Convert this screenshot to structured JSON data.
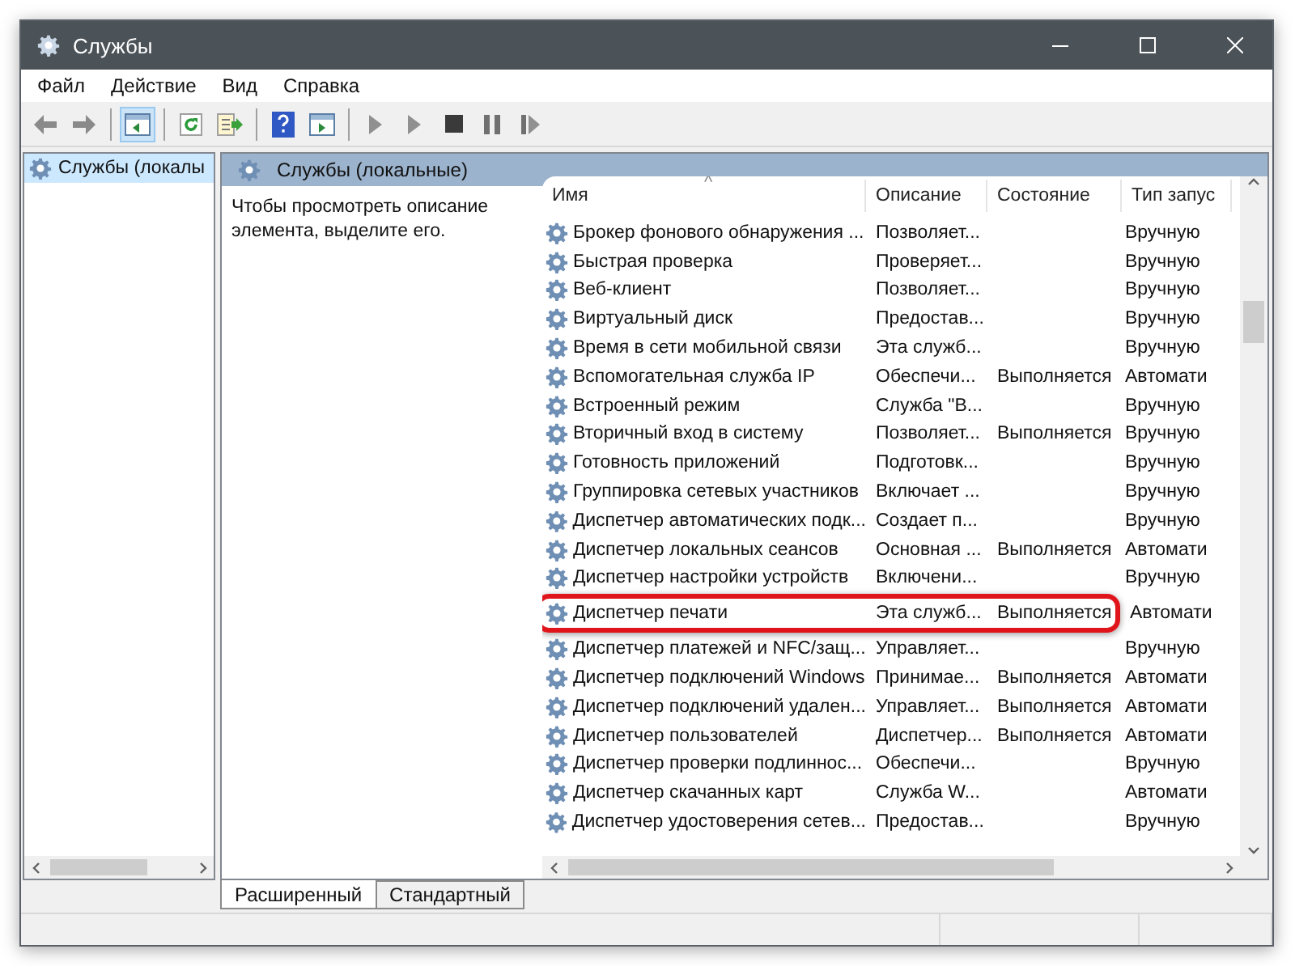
{
  "window": {
    "title": "Службы"
  },
  "menu": [
    "Файл",
    "Действие",
    "Вид",
    "Справка"
  ],
  "toolbar": [
    {
      "kind": "back",
      "pressed": false
    },
    {
      "kind": "forward",
      "pressed": false
    },
    {
      "kind": "sep"
    },
    {
      "kind": "tree",
      "pressed": true
    },
    {
      "kind": "sep"
    },
    {
      "kind": "refresh",
      "pressed": false
    },
    {
      "kind": "export",
      "pressed": false
    },
    {
      "kind": "sep"
    },
    {
      "kind": "help",
      "pressed": false
    },
    {
      "kind": "view",
      "pressed": false
    },
    {
      "kind": "sep"
    },
    {
      "kind": "start",
      "pressed": false
    },
    {
      "kind": "start",
      "pressed": false
    },
    {
      "kind": "stop",
      "pressed": false
    },
    {
      "kind": "pause",
      "pressed": false
    },
    {
      "kind": "resume",
      "pressed": false
    }
  ],
  "tree": {
    "items": [
      {
        "label": "Службы (локалы",
        "selected": true
      }
    ]
  },
  "panel": {
    "title": "Службы (локальные)",
    "description": "Чтобы просмотреть описание элемента, выделите его."
  },
  "table": {
    "sort_indicator": "^",
    "columns": [
      "Имя",
      "Описание",
      "Состояние",
      "Тип запус"
    ],
    "rows": [
      {
        "name": "Брокер фонового обнаружения ...",
        "description": "Позволяет...",
        "startup": "Вручную",
        "highlighted": false
      },
      {
        "name": "Быстрая проверка",
        "description": "Проверяет...",
        "startup": "Вручную",
        "highlighted": false
      },
      {
        "name": "Веб-клиент",
        "description": "Позволяет...",
        "startup": "Вручную",
        "highlighted": false
      },
      {
        "name": "Виртуальный диск",
        "description": "Предостав...",
        "startup": "Вручную",
        "highlighted": false
      },
      {
        "name": "Время в сети мобильной связи",
        "description": "Эта служб...",
        "startup": "Вручную",
        "highlighted": false
      },
      {
        "name": "Вспомогательная служба IP",
        "description": "Обеспечи...",
        "status": "Выполняется",
        "startup": "Автомати",
        "highlighted": false
      },
      {
        "name": "Встроенный режим",
        "description": "Служба \"В...",
        "startup": "Вручную",
        "highlighted": false
      },
      {
        "name": "Вторичный вход в систему",
        "description": "Позволяет...",
        "status": "Выполняется",
        "startup": "Вручную",
        "highlighted": false
      },
      {
        "name": "Готовность приложений",
        "description": "Подготовк...",
        "startup": "Вручную",
        "highlighted": false
      },
      {
        "name": "Группировка сетевых участников",
        "description": "Включает ...",
        "startup": "Вручную",
        "highlighted": false
      },
      {
        "name": "Диспетчер автоматических подк...",
        "description": "Создает п...",
        "startup": "Вручную",
        "highlighted": false
      },
      {
        "name": "Диспетчер локальных сеансов",
        "description": "Основная ...",
        "status": "Выполняется",
        "startup": "Автомати",
        "highlighted": false
      },
      {
        "name": "Диспетчер настройки устройств",
        "description": "Включени...",
        "startup": "Вручную",
        "highlighted": false
      },
      {
        "name": "Диспетчер печати",
        "description": "Эта служб...",
        "status": "Выполняется",
        "startup": "Автомати",
        "highlighted": true
      },
      {
        "name": "Диспетчер платежей и NFC/защ...",
        "description": "Управляет...",
        "startup": "Вручную",
        "highlighted": false
      },
      {
        "name": "Диспетчер подключений Windows",
        "description": "Принимае...",
        "status": "Выполняется",
        "startup": "Автомати",
        "highlighted": false
      },
      {
        "name": "Диспетчер подключений удален...",
        "description": "Управляет...",
        "status": "Выполняется",
        "startup": "Автомати",
        "highlighted": false
      },
      {
        "name": "Диспетчер пользователей",
        "description": "Диспетчер...",
        "status": "Выполняется",
        "startup": "Автомати",
        "highlighted": false
      },
      {
        "name": "Диспетчер проверки подлиннос...",
        "description": "Обеспечи...",
        "startup": "Вручную",
        "highlighted": false
      },
      {
        "name": "Диспетчер скачанных карт",
        "description": "Служба W...",
        "startup": "Автомати",
        "highlighted": false
      },
      {
        "name": "Диспетчер удостоверения сетев...",
        "description": "Предостав...",
        "startup": "Вручную",
        "highlighted": false
      }
    ]
  },
  "view_tabs": [
    {
      "label": "Расширенный",
      "selected": true
    },
    {
      "label": "Стандартный",
      "selected": false
    }
  ]
}
